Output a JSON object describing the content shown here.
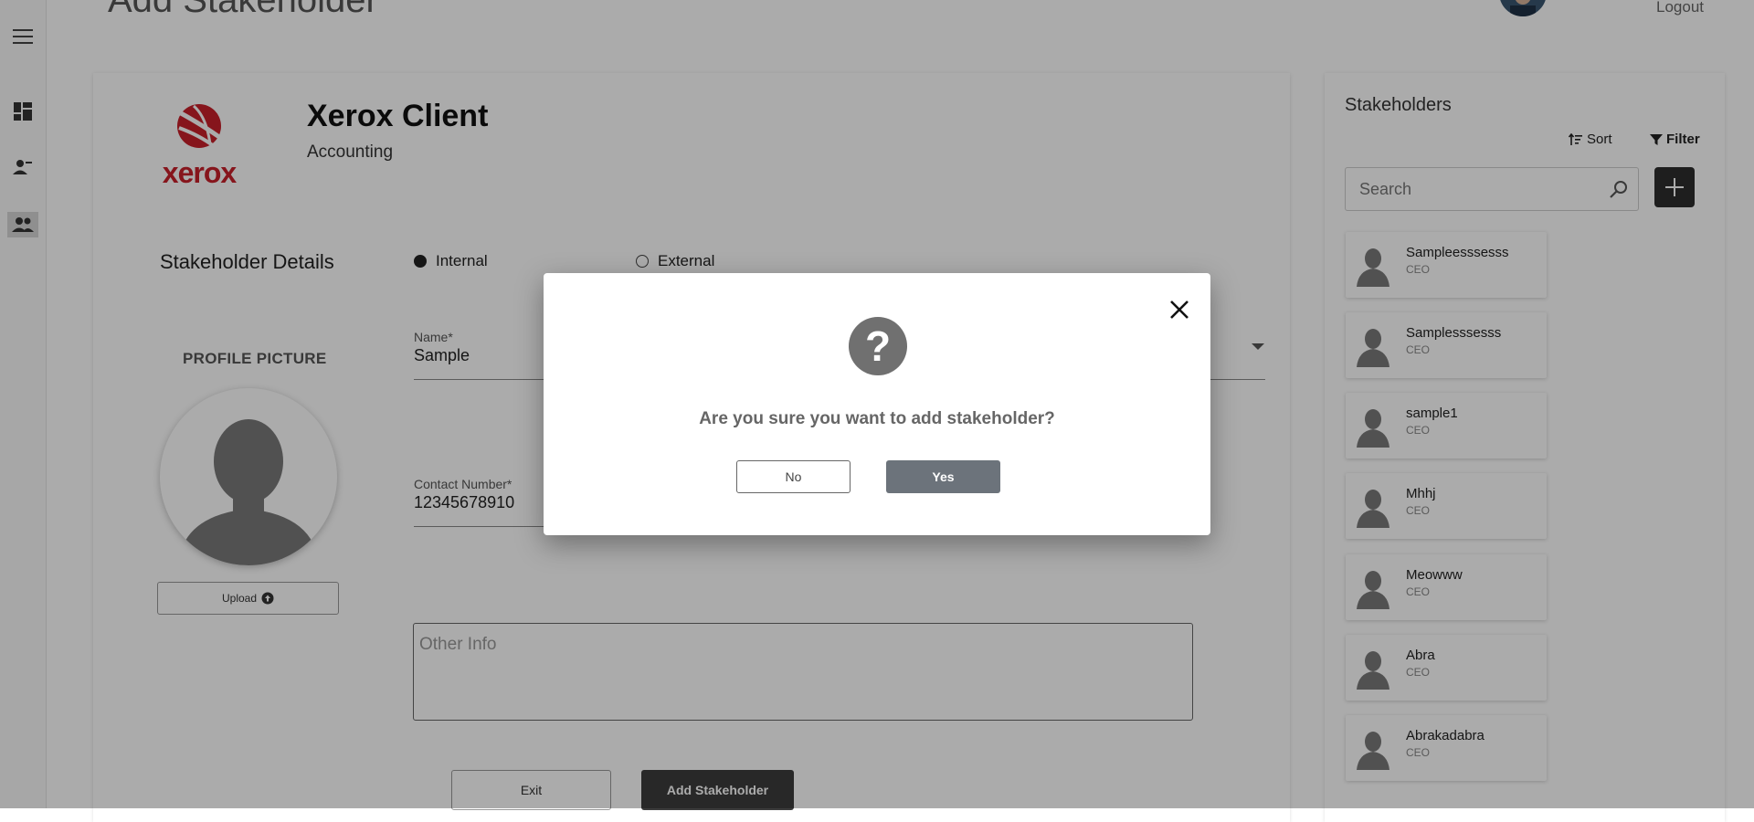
{
  "header": {
    "page_title": "Add Stakeholder",
    "logout_label": "Logout"
  },
  "client": {
    "logo_text": "xerox",
    "name": "Xerox Client",
    "department": "Accounting"
  },
  "details": {
    "section_title": "Stakeholder Details",
    "radio_internal": "Internal",
    "radio_external": "External",
    "selected_type": "Internal",
    "profile_picture_label": "PROFILE PICTURE",
    "upload_label": "Upload",
    "name_label": "Name*",
    "name_value": "Sample",
    "contact_label": "Contact Number*",
    "contact_value": "12345678910",
    "other_info_placeholder": "Other Info",
    "exit_label": "Exit",
    "add_label": "Add Stakeholder"
  },
  "stakeholders": {
    "title": "Stakeholders",
    "sort_label": "Sort",
    "filter_label": "Filter",
    "search_placeholder": "Search",
    "items": [
      {
        "name": "Sampleesssesss",
        "role": "CEO"
      },
      {
        "name": "Samplesssesss",
        "role": "CEO"
      },
      {
        "name": "sample1",
        "role": "CEO"
      },
      {
        "name": "Mhhj",
        "role": "CEO"
      },
      {
        "name": "Meowww",
        "role": "CEO"
      },
      {
        "name": "Abra",
        "role": "CEO"
      },
      {
        "name": "Abrakadabra",
        "role": "CEO"
      }
    ]
  },
  "modal": {
    "icon": "?",
    "message": "Are you sure you want to add stakeholder?",
    "no_label": "No",
    "yes_label": "Yes"
  },
  "colors": {
    "logo_red": "#c8202a",
    "primary_dark": "#3c3c3c",
    "yes_button": "#6c737b"
  }
}
